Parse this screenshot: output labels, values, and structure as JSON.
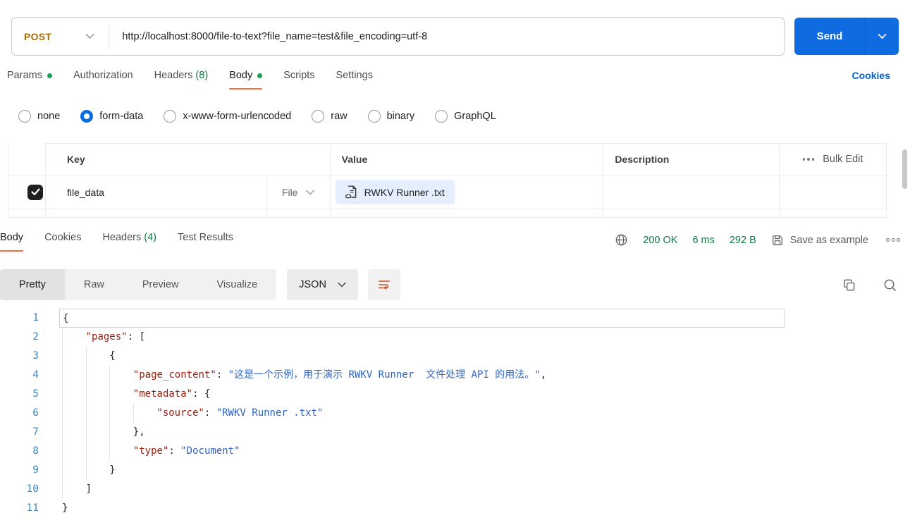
{
  "request": {
    "method": "POST",
    "url": "http://localhost:8000/file-to-text?file_name=test&file_encoding=utf-8",
    "send_label": "Send"
  },
  "request_tabs": {
    "items": [
      {
        "label": "Params",
        "has_dot": true
      },
      {
        "label": "Authorization"
      },
      {
        "label": "Headers",
        "count": "(8)"
      },
      {
        "label": "Body",
        "has_dot": true,
        "active": true
      },
      {
        "label": "Scripts"
      },
      {
        "label": "Settings"
      }
    ],
    "cookies_link": "Cookies"
  },
  "body_modes": {
    "options": [
      "none",
      "form-data",
      "x-www-form-urlencoded",
      "raw",
      "binary",
      "GraphQL"
    ],
    "selected": "form-data"
  },
  "form_data_table": {
    "columns": [
      "Key",
      "Value",
      "Description"
    ],
    "bulk_edit_label": "Bulk Edit",
    "rows": [
      {
        "checked": true,
        "key": "file_data",
        "value_type": "File",
        "value_file": "RWKV Runner .txt",
        "description": ""
      }
    ]
  },
  "response": {
    "tabs": [
      {
        "label": "Body",
        "active": true
      },
      {
        "label": "Cookies"
      },
      {
        "label": "Headers",
        "count": "(4)"
      },
      {
        "label": "Test Results"
      }
    ],
    "status": "200 OK",
    "time": "6 ms",
    "size": "292 B",
    "save_as_example_label": "Save as example",
    "viewer": {
      "views": [
        "Pretty",
        "Raw",
        "Preview",
        "Visualize"
      ],
      "active_view": "Pretty",
      "format": "JSON"
    },
    "code": {
      "language": "json",
      "lines": [
        {
          "n": 1,
          "indent": 0,
          "active": true,
          "tokens": [
            {
              "t": "p",
              "v": "{"
            }
          ]
        },
        {
          "n": 2,
          "indent": 1,
          "tokens": [
            {
              "t": "k",
              "v": "\"pages\""
            },
            {
              "t": "p",
              "v": ": ["
            }
          ]
        },
        {
          "n": 3,
          "indent": 2,
          "tokens": [
            {
              "t": "p",
              "v": "{"
            }
          ]
        },
        {
          "n": 4,
          "indent": 3,
          "tokens": [
            {
              "t": "k",
              "v": "\"page_content\""
            },
            {
              "t": "p",
              "v": ": "
            },
            {
              "t": "s",
              "v": "\"这是一个示例，用于演示 RWKV Runner  文件处理 API 的用法。\""
            },
            {
              "t": "p",
              "v": ","
            }
          ]
        },
        {
          "n": 5,
          "indent": 3,
          "tokens": [
            {
              "t": "k",
              "v": "\"metadata\""
            },
            {
              "t": "p",
              "v": ": {"
            }
          ]
        },
        {
          "n": 6,
          "indent": 4,
          "tokens": [
            {
              "t": "k",
              "v": "\"source\""
            },
            {
              "t": "p",
              "v": ": "
            },
            {
              "t": "s",
              "v": "\"RWKV Runner .txt\""
            }
          ]
        },
        {
          "n": 7,
          "indent": 3,
          "tokens": [
            {
              "t": "p",
              "v": "},"
            }
          ]
        },
        {
          "n": 8,
          "indent": 3,
          "tokens": [
            {
              "t": "k",
              "v": "\"type\""
            },
            {
              "t": "p",
              "v": ": "
            },
            {
              "t": "s",
              "v": "\"Document\""
            }
          ]
        },
        {
          "n": 9,
          "indent": 2,
          "tokens": [
            {
              "t": "p",
              "v": "}"
            }
          ]
        },
        {
          "n": 10,
          "indent": 1,
          "tokens": [
            {
              "t": "p",
              "v": "]"
            }
          ]
        },
        {
          "n": 11,
          "indent": 0,
          "tokens": [
            {
              "t": "p",
              "v": "}"
            }
          ]
        }
      ]
    }
  },
  "colors": {
    "accent_orange": "#ff6c37",
    "status_green": "#0c7a3e",
    "primary_blue": "#0f6ce0",
    "method_post": "#a86a03",
    "code_key": "#9e2010",
    "code_string": "#3064c2",
    "line_number": "#3e87c4"
  }
}
